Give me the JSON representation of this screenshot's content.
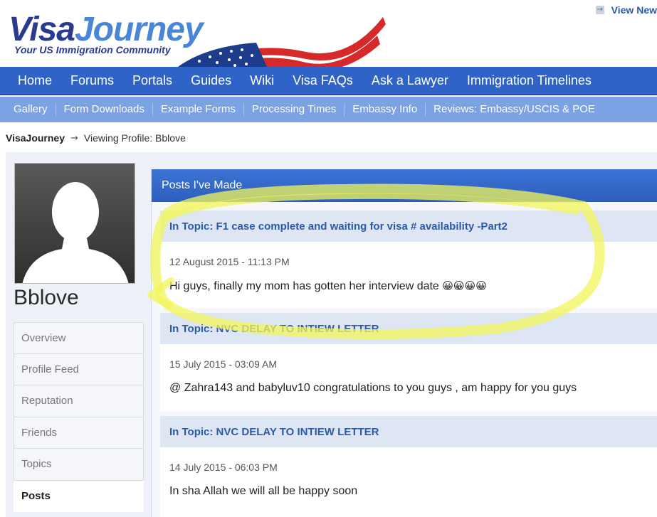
{
  "header": {
    "logo_visa": "Visa",
    "logo_journey": "Journey",
    "tagline": "Your US Immigration Community",
    "view_new": "View New",
    "view_new_icon": "→"
  },
  "nav_primary": [
    "Home",
    "Forums",
    "Portals",
    "Guides",
    "Wiki",
    "Visa FAQs",
    "Ask a Lawyer",
    "Immigration Timelines"
  ],
  "nav_secondary": [
    "Gallery",
    "Form Downloads",
    "Example Forms",
    "Processing Times",
    "Embassy Info",
    "Reviews: Embassy/USCIS & POE"
  ],
  "breadcrumb": {
    "home": "VisaJourney",
    "arrow": "→",
    "current": "Viewing Profile: Bblove"
  },
  "profile": {
    "name": "Bblove",
    "menu": [
      "Overview",
      "Profile Feed",
      "Reputation",
      "Friends",
      "Topics",
      "Posts"
    ],
    "active_menu": "Posts"
  },
  "posts_panel": {
    "title": "Posts I've Made",
    "posts": [
      {
        "topic": "In Topic: F1 case complete and waiting for visa # availability -Part2",
        "date": "12 August 2015 - 11:13 PM",
        "body": "Hi guys, finally my mom has gotten her interview date",
        "emoji": "😀😀😀😀"
      },
      {
        "topic": "In Topic: NVC DELAY TO INTIEW LETTER",
        "date": "15 July 2015 - 03:09 AM",
        "body": "@ Zahra143 and babyluv10 congratulations to you guys , am happy for you guys",
        "emoji": ""
      },
      {
        "topic": "In Topic: NVC DELAY TO INTIEW LETTER",
        "date": "14 July 2015 - 06:03 PM",
        "body": "In sha Allah we will all be happy soon",
        "emoji": ""
      }
    ]
  },
  "colors": {
    "nav_primary": "#2f63c8",
    "nav_secondary": "#7aa2e4",
    "topic_text": "#2d5aa8",
    "highlight": "#f2f55a"
  },
  "icons": {
    "avatar": "default-avatar-silhouette",
    "flag": "us-flag-graphic"
  }
}
